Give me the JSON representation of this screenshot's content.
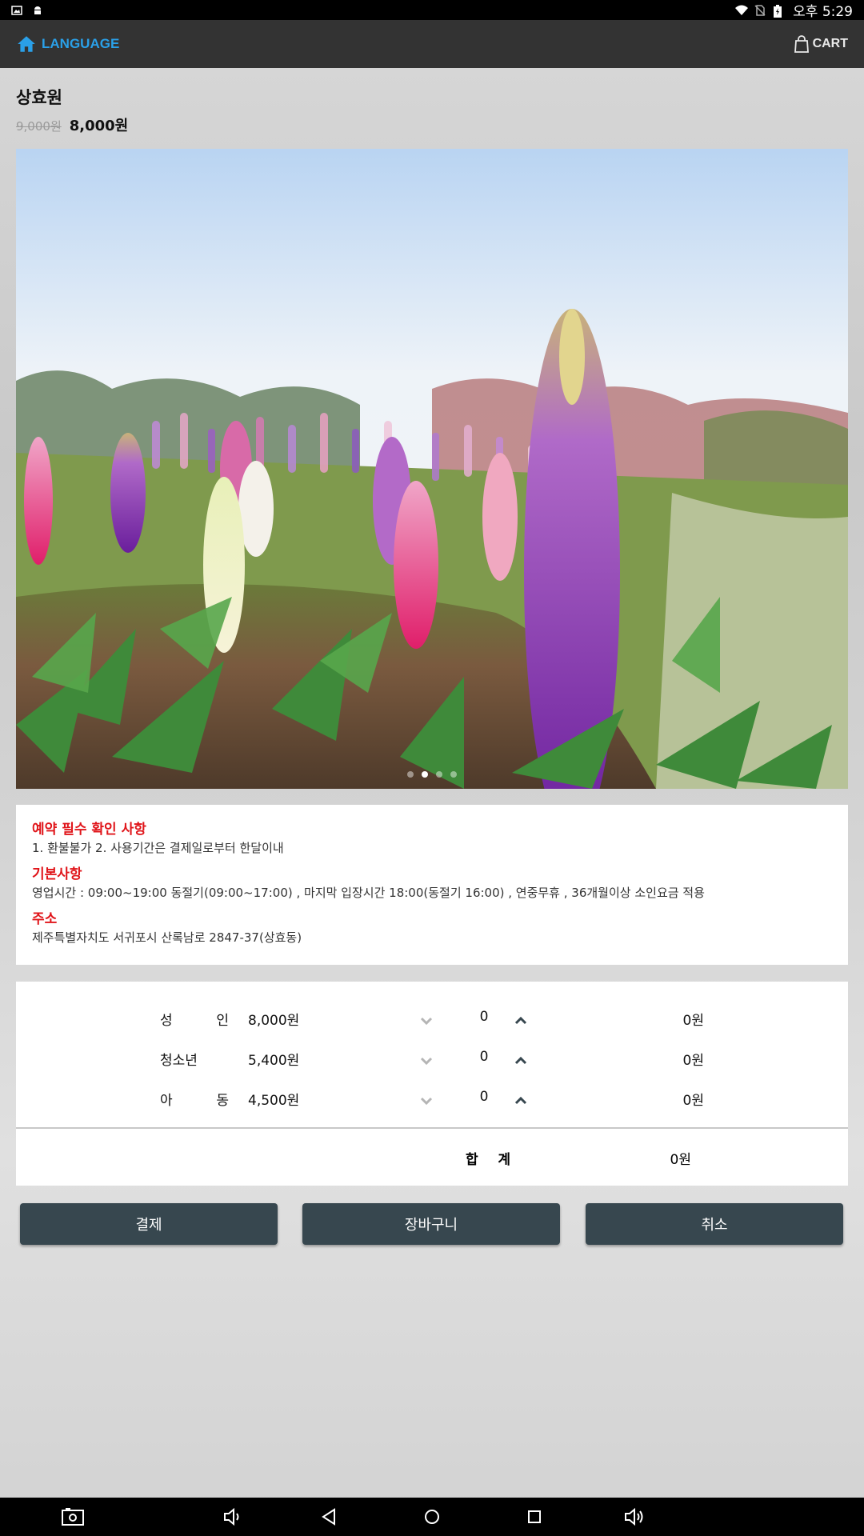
{
  "status_bar": {
    "time": "오후 5:29",
    "icons": [
      "image-icon",
      "android-icon",
      "wifi-icon",
      "no-sim-icon",
      "battery-icon"
    ]
  },
  "app_bar": {
    "language_label": "LANGUAGE",
    "cart_label": "CART",
    "accent_color": "#2aa0e8"
  },
  "product": {
    "name": "상효원",
    "original_price": "9,000원",
    "sale_price": "8,000원",
    "image_count": 4,
    "active_image_index": 1
  },
  "info": {
    "sections": [
      {
        "heading": "예약 필수 확인 사항",
        "text": "1. 환불불가 2. 사용기간은 결제일로부터 한달이내"
      },
      {
        "heading": "기본사항",
        "text": "영업시간 : 09:00~19:00 동절기(09:00~17:00) , 마지막 입장시간 18:00(동절기 16:00) , 연중무휴 , 36개월이상 소인요금 적용"
      },
      {
        "heading": "주소",
        "text": "제주특별자치도 서귀포시 산록남로 2847-37(상효동)"
      }
    ],
    "heading_color": "#e0151a"
  },
  "tickets": {
    "rows": [
      {
        "label": "성 인",
        "price": "8,000원",
        "qty": "0",
        "subtotal": "0원"
      },
      {
        "label": "청소년",
        "price": "5,400원",
        "qty": "0",
        "subtotal": "0원"
      },
      {
        "label": "아 동",
        "price": "4,500원",
        "qty": "0",
        "subtotal": "0원"
      }
    ],
    "total_label": "합 계",
    "total_value": "0원"
  },
  "actions": {
    "pay_label": "결제",
    "cart_label": "장바구니",
    "cancel_label": "취소",
    "button_color": "#37474f"
  },
  "nav_bar": {
    "icons": [
      "screenshot-icon",
      "volume-down-icon",
      "back-icon",
      "home-icon",
      "recents-icon",
      "volume-up-icon"
    ]
  }
}
